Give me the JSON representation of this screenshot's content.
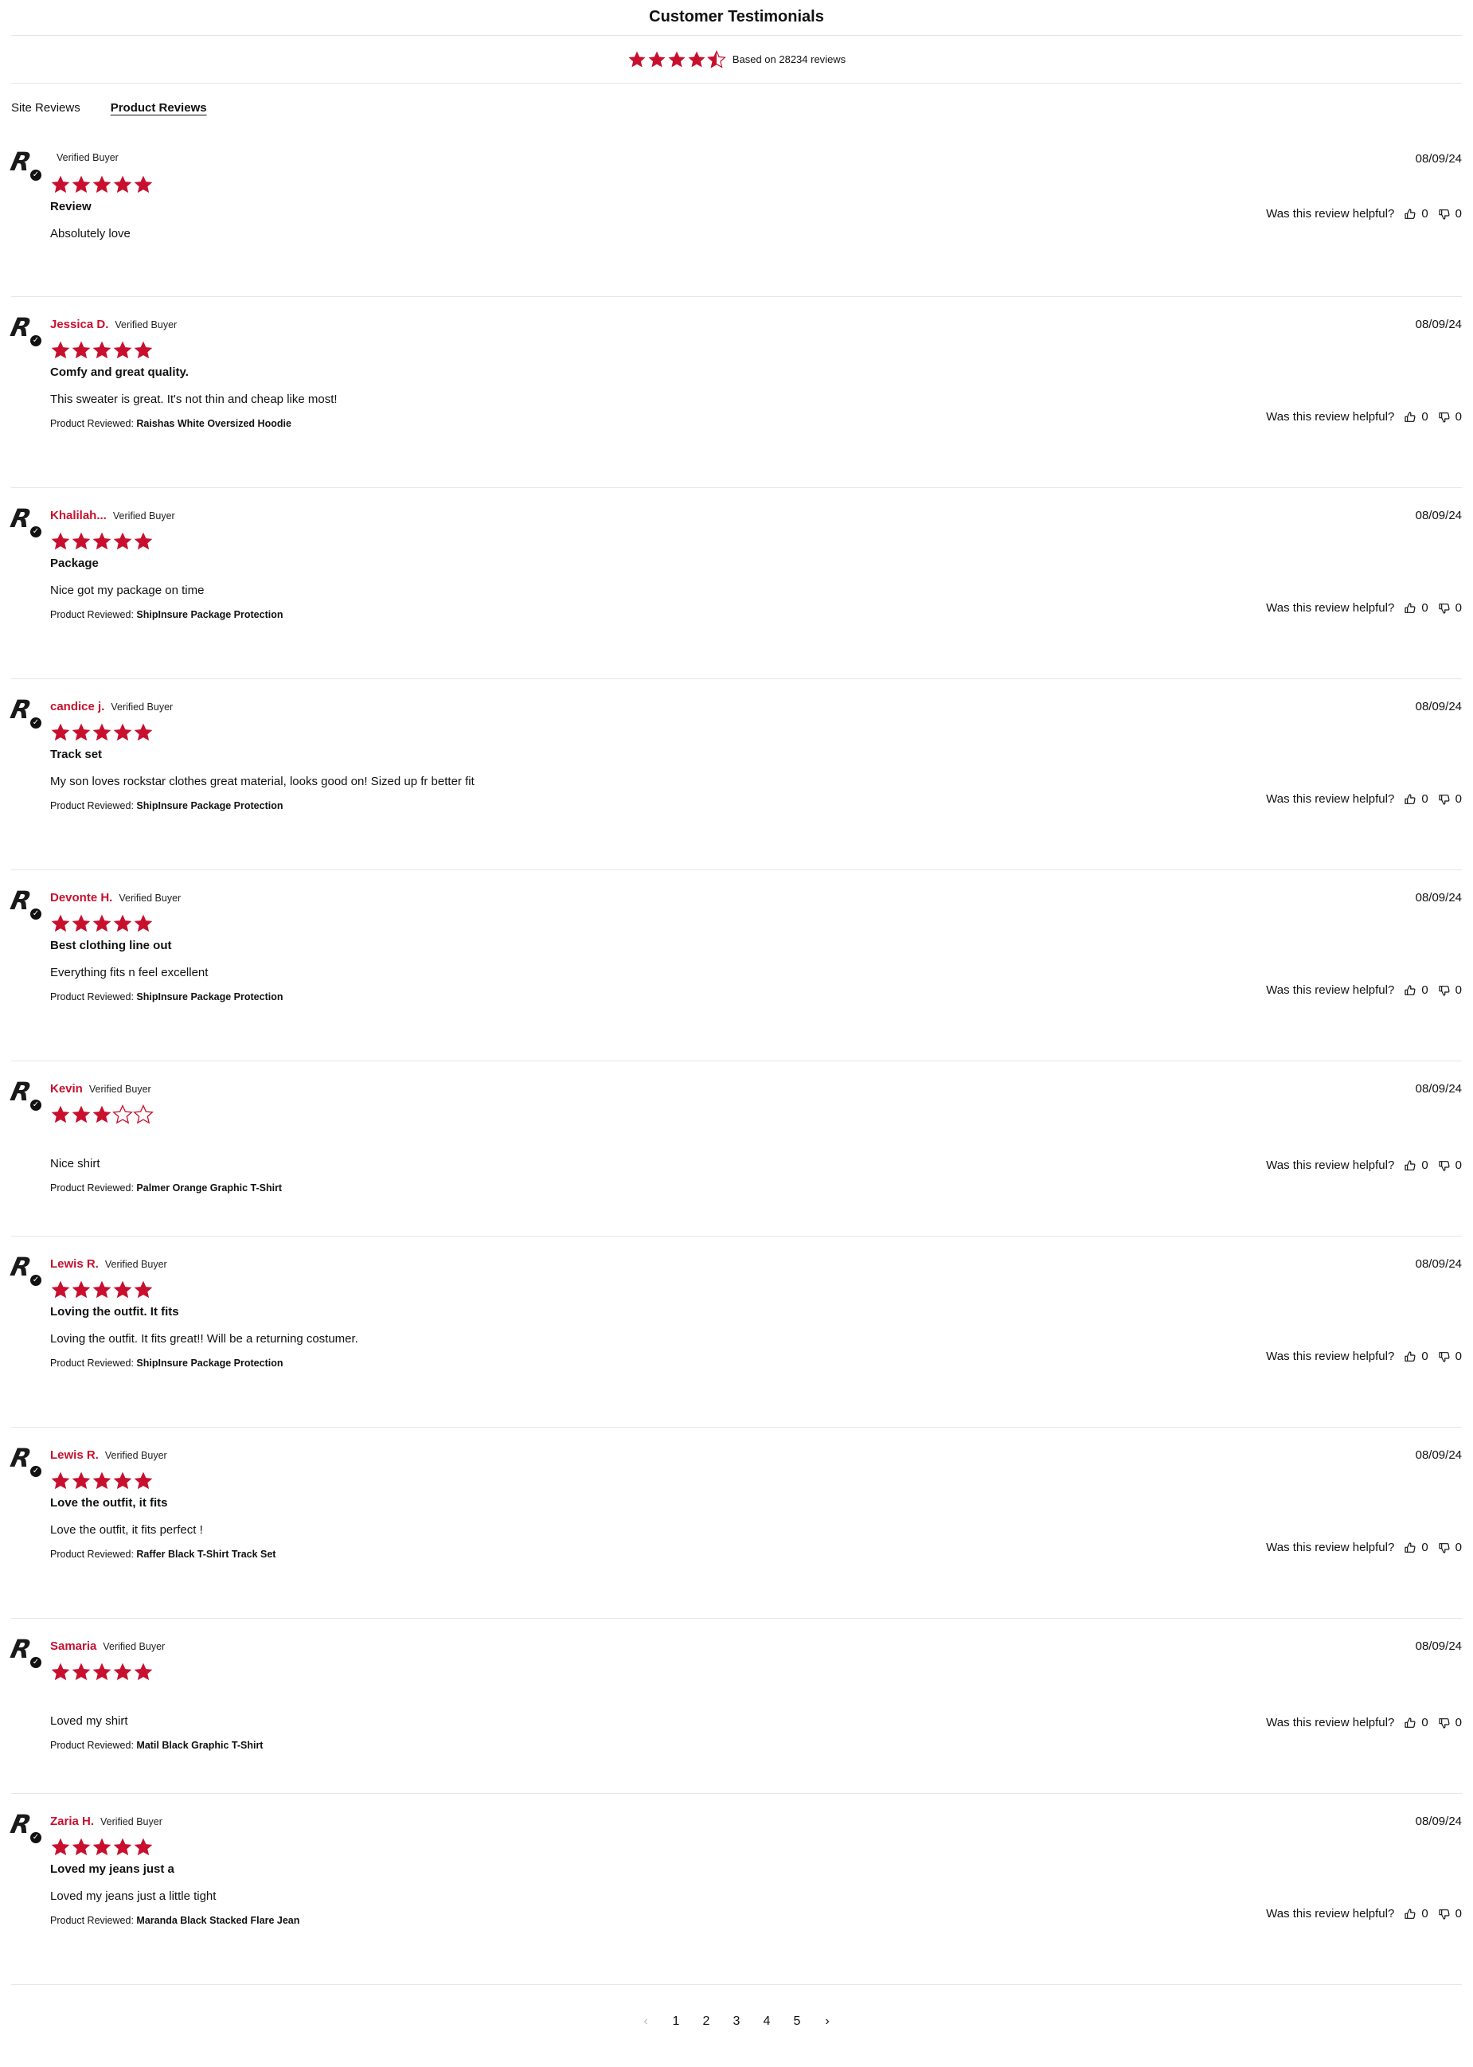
{
  "page": {
    "title": "Customer Testimonials",
    "summary": "Based on 28234 reviews",
    "rating": 4.5,
    "tabs": [
      "Site Reviews",
      "Product Reviews"
    ],
    "active_tab": 1,
    "accent_color": "#c8102e",
    "helpful_label": "Was this review helpful?",
    "product_label": "Product Reviewed:"
  },
  "reviews": [
    {
      "name": "",
      "verified": "Verified Buyer",
      "rating": 5,
      "title": "Review",
      "body": "Absolutely love",
      "product": "",
      "date": "08/09/24",
      "up": "0",
      "down": "0"
    },
    {
      "name": "Jessica D.",
      "verified": "Verified Buyer",
      "rating": 5,
      "title": "Comfy and great quality.",
      "body": "This sweater is great. It's not thin and cheap like most!",
      "product": "Raishas White Oversized Hoodie",
      "date": "08/09/24",
      "up": "0",
      "down": "0"
    },
    {
      "name": "Khalilah...",
      "verified": "Verified Buyer",
      "rating": 5,
      "title": "Package",
      "body": "Nice got my package on time",
      "product": "ShipInsure Package Protection",
      "date": "08/09/24",
      "up": "0",
      "down": "0"
    },
    {
      "name": "candice j.",
      "verified": "Verified Buyer",
      "rating": 5,
      "title": "Track set",
      "body": "My son loves rockstar clothes great material, looks good on! Sized up fr better fit",
      "product": "ShipInsure Package Protection",
      "date": "08/09/24",
      "up": "0",
      "down": "0"
    },
    {
      "name": "Devonte H.",
      "verified": "Verified Buyer",
      "rating": 5,
      "title": "Best clothing line out",
      "body": "Everything fits n feel excellent",
      "product": "ShipInsure Package Protection",
      "date": "08/09/24",
      "up": "0",
      "down": "0"
    },
    {
      "name": "Kevin",
      "verified": "Verified Buyer",
      "rating": 3,
      "title": "",
      "body": "Nice shirt",
      "product": "Palmer Orange Graphic T-Shirt",
      "date": "08/09/24",
      "up": "0",
      "down": "0"
    },
    {
      "name": "Lewis R.",
      "verified": "Verified Buyer",
      "rating": 5,
      "title": "Loving the outfit. It fits",
      "body": "Loving the outfit. It fits great!! Will be a returning costumer.",
      "product": "ShipInsure Package Protection",
      "date": "08/09/24",
      "up": "0",
      "down": "0"
    },
    {
      "name": "Lewis R.",
      "verified": "Verified Buyer",
      "rating": 5,
      "title": "Love the outfit, it fits",
      "body": "Love the outfit, it fits perfect !",
      "product": "Raffer Black T-Shirt Track Set",
      "date": "08/09/24",
      "up": "0",
      "down": "0"
    },
    {
      "name": "Samaria",
      "verified": "Verified Buyer",
      "rating": 5,
      "title": "",
      "body": "Loved my shirt",
      "product": "Matil Black Graphic T-Shirt",
      "date": "08/09/24",
      "up": "0",
      "down": "0"
    },
    {
      "name": "Zaria H.",
      "verified": "Verified Buyer",
      "rating": 5,
      "title": "Loved my jeans just a",
      "body": "Loved my jeans just a little tight",
      "product": "Maranda Black Stacked Flare Jean",
      "date": "08/09/24",
      "up": "0",
      "down": "0"
    }
  ],
  "pagination": {
    "prev": "‹",
    "pages": [
      "1",
      "2",
      "3",
      "4",
      "5"
    ],
    "next": "›"
  }
}
